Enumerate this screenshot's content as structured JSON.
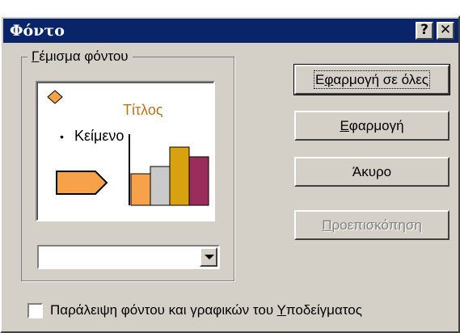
{
  "dialog": {
    "title": "Φόντο",
    "help_glyph": "?",
    "close_glyph": "✕"
  },
  "fill_group": {
    "label_accel": "Γ",
    "label_rest": "έμισμα φόντου",
    "combo_value": ""
  },
  "preview": {
    "title": "Τίτλος",
    "bullet": "•",
    "body": "Κείμενο",
    "chart_values": [
      0.46,
      0.57,
      0.86,
      0.71
    ],
    "colors": {
      "title": "#b8741a",
      "diamond": "#f7a24a",
      "arrow": "#f7a24a",
      "bars": [
        "#f7a24a",
        "#c9c9c9",
        "#d7a10f",
        "#9a2c5c"
      ]
    }
  },
  "buttons": {
    "apply_all": {
      "pre": "Ε",
      "accel": "φ",
      "post": "αρμογή σε όλες"
    },
    "apply": {
      "pre": "",
      "accel": "Ε",
      "post": "φαρμογή"
    },
    "cancel": {
      "label": "Άκυρο"
    },
    "preview": {
      "pre": "",
      "accel": "Π",
      "post": "ροεπισκόπηση"
    }
  },
  "omit_graphics": {
    "checked": false,
    "pre": "Παράλειψη φόντου και γραφικών του ",
    "accel": "Υ",
    "post": "ποδείγματος"
  }
}
